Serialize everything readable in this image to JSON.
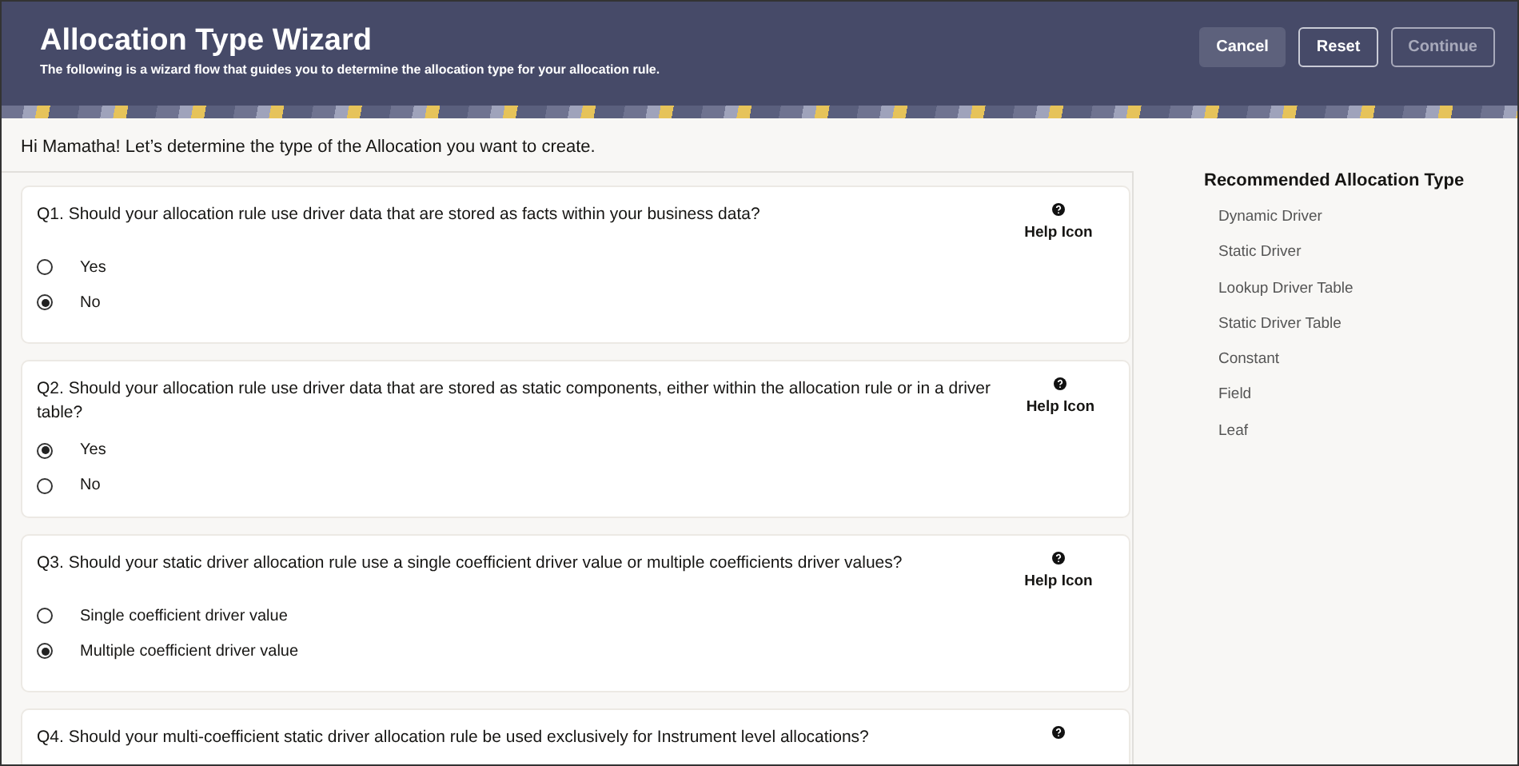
{
  "header": {
    "title": "Allocation Type Wizard",
    "subtitle": "The following is a wizard flow that guides you to determine the allocation type for your allocation rule.",
    "buttons": [
      {
        "label": "Cancel",
        "kind": "secondary",
        "disabled": false
      },
      {
        "label": "Reset",
        "kind": "outline",
        "disabled": false
      },
      {
        "label": "Continue",
        "kind": "primary",
        "disabled": true
      }
    ]
  },
  "greeting": "Hi Mamatha! Let’s determine the type of the Allocation you want to create.",
  "questions": [
    {
      "text": "Q1. Should your allocation rule use driver data that are stored as facts within your business data?",
      "help_label": "Help Icon",
      "options": [
        {
          "label": "Yes",
          "selected": false
        },
        {
          "label": "No",
          "selected": true
        }
      ]
    },
    {
      "text": "Q2. Should your allocation rule use driver data that are stored as static components, either within the allocation rule or in a driver table?",
      "help_label": "Help Icon",
      "options": [
        {
          "label": "Yes",
          "selected": true
        },
        {
          "label": "No",
          "selected": false
        }
      ]
    },
    {
      "text": "Q3. Should your static driver allocation rule use a single coefficient driver value or multiple coefficients driver values?",
      "help_label": "Help Icon",
      "options": [
        {
          "label": "Single coefficient driver value",
          "selected": false
        },
        {
          "label": "Multiple coefficient driver value",
          "selected": true
        }
      ]
    },
    {
      "text": "Q4. Should your multi-coefficient static driver allocation rule be used exclusively for Instrument level allocations?"
    }
  ],
  "recommended": {
    "title": "Recommended Allocation Type",
    "items": [
      "Dynamic Driver",
      "Static Driver",
      "Lookup Driver Table",
      "Static Driver Table",
      "Constant",
      "Field",
      "Leaf"
    ]
  }
}
